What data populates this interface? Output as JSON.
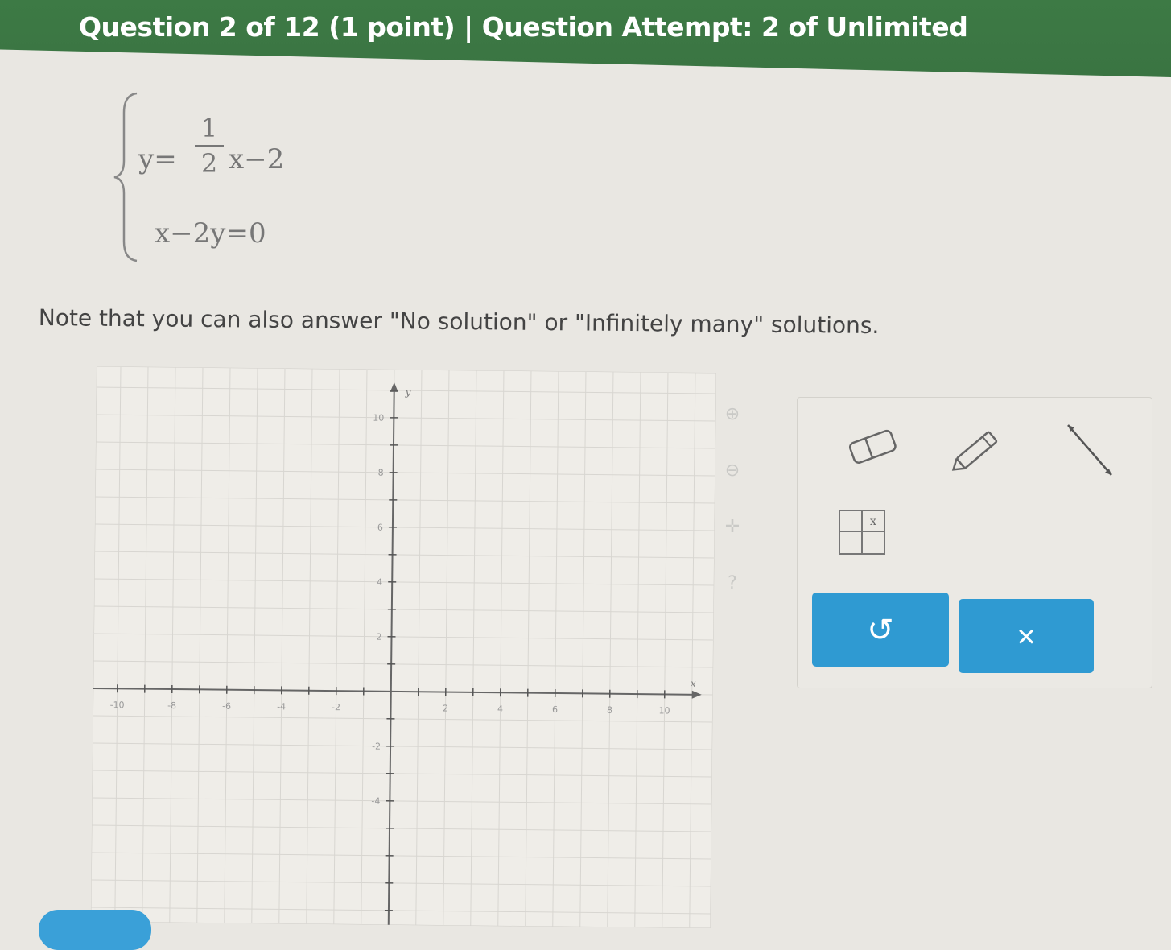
{
  "header": {
    "title": "Question 2 of 12 (1 point)  |  Question Attempt: 2 of Unlimited"
  },
  "system": {
    "eq1_lhs": "y=",
    "eq1_num": "1",
    "eq1_den": "2",
    "eq1_rhs": "x−2",
    "eq2": "x−2y=0"
  },
  "note": "Note that you can also answer \"No solution\" or \"Infinitely many\" solutions.",
  "graph": {
    "y_axis_label": "y",
    "x_axis_label": "x",
    "y_ticks": [
      "10",
      "8",
      "6",
      "4",
      "2",
      "-2",
      "-4"
    ],
    "x_ticks": [
      "-10",
      "-8",
      "-6",
      "-4",
      "-2",
      "2",
      "4",
      "6",
      "8",
      "10"
    ]
  },
  "toolbox": {
    "eraser": "eraser-icon",
    "pencil": "pencil-icon",
    "line": "line-icon",
    "table": "table-icon",
    "table_label": "x",
    "undo": "↺",
    "clear": "×"
  },
  "colors": {
    "header": "#3d7a45",
    "button": "#2f9ad2"
  }
}
